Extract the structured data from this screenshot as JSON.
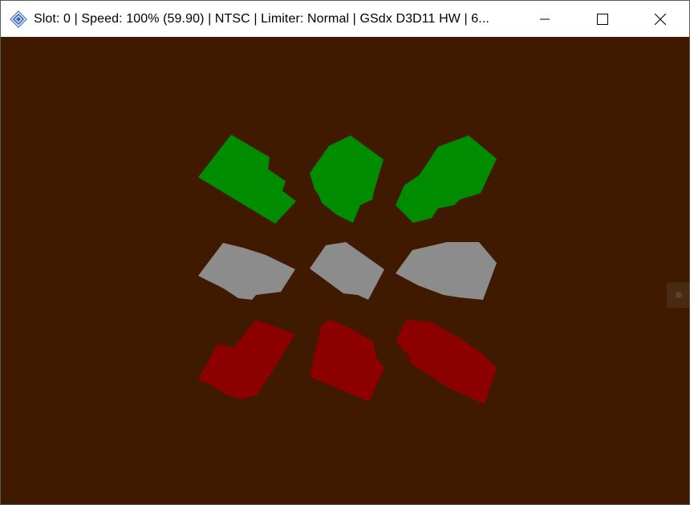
{
  "window": {
    "title": "Slot: 0 | Speed: 100% (59.90) | NTSC | Limiter: Normal | GSdx D3D11 HW | 6...",
    "app_icon": "pcsx2-icon",
    "controls": {
      "minimize_icon": "minimize-icon",
      "maximize_icon": "maximize-icon",
      "close_icon": "close-icon"
    }
  },
  "viewport": {
    "background_color": "#3f1a00",
    "shape_colors": {
      "top_row": "#008c00",
      "middle_row": "#8c8c8c",
      "bottom_row": "#8c0000"
    },
    "side_handle_icon": "panel-handle-icon"
  }
}
